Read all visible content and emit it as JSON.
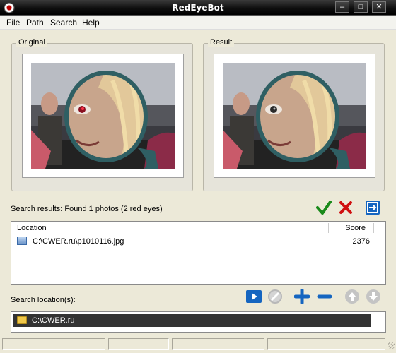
{
  "window": {
    "title": "RedEyeBot"
  },
  "menu": [
    "File",
    "Path",
    "Search",
    "Help"
  ],
  "original": {
    "label": "Original"
  },
  "result": {
    "label": "Result"
  },
  "results": {
    "summary": "Search results: Found 1 photos (2 red eyes)",
    "columns": {
      "location": "Location",
      "score": "Score"
    },
    "rows": [
      {
        "path": "C:\\CWER.ru\\p1010116.jpg",
        "score": "2376"
      }
    ]
  },
  "search_locations": {
    "label": "Search location(s):",
    "items": [
      "C:\\CWER.ru"
    ]
  },
  "colors": {
    "accept": "#1a8a1a",
    "reject": "#d01010",
    "action_blue": "#1565c0",
    "disabled": "#b8b8b8"
  },
  "icons": [
    "accept-icon",
    "reject-icon",
    "export-icon",
    "play-icon",
    "cancel-icon",
    "add-icon",
    "remove-icon",
    "move-up-icon",
    "move-down-icon"
  ]
}
